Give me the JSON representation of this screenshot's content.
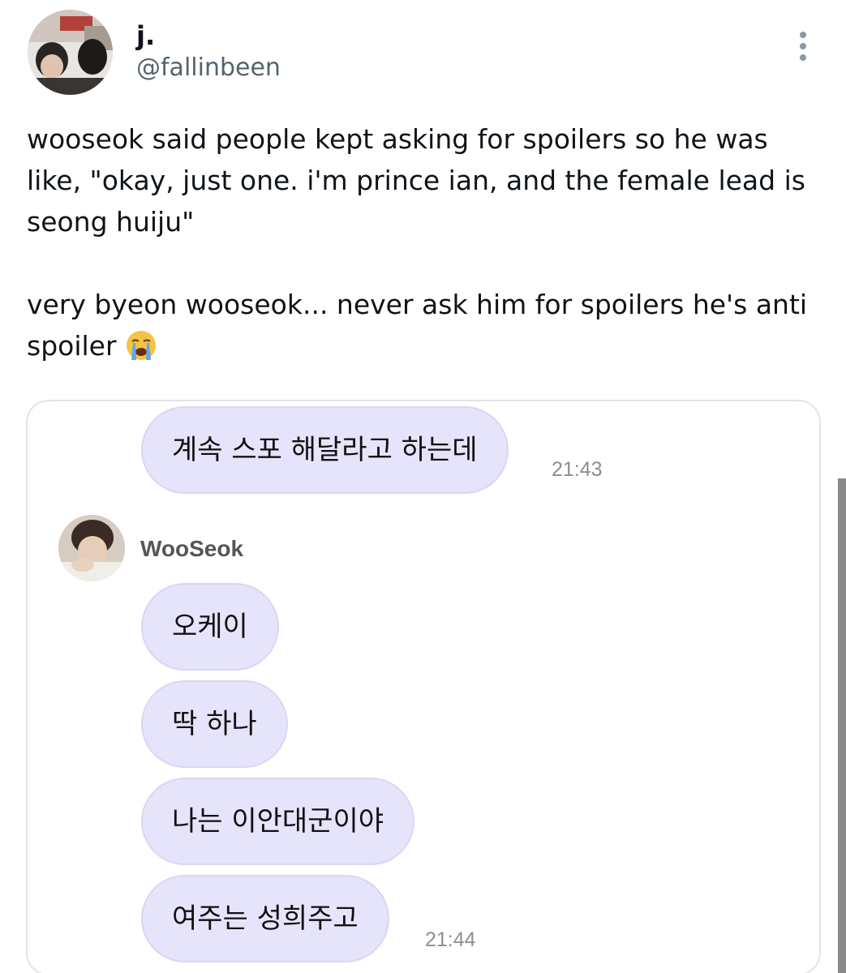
{
  "tweet": {
    "display_name": "j.",
    "handle": "@fallinbeen",
    "text_main": "wooseok said people kept asking for spoilers so he was like, \"okay, just one. i'm prince ian, and the female lead is seong huiju\"\n\nvery byeon wooseok... never ask him for spoilers he's anti spoiler ",
    "emoji": "loudly-crying-face-icon"
  },
  "chat": {
    "messages_sent": [
      {
        "text": "계속 스포 해달라고 하는데",
        "time": "21:43"
      }
    ],
    "sender_name": "WooSeok",
    "messages_received": [
      {
        "text": "오케이"
      },
      {
        "text": "딱 하나"
      },
      {
        "text": "나는 이안대군이야"
      },
      {
        "text": "여주는 성희주고",
        "time": "21:44"
      }
    ]
  },
  "colors": {
    "bubble_bg": "#e6e4fb",
    "handle": "#536471",
    "timestamp": "#8e8e8e"
  }
}
